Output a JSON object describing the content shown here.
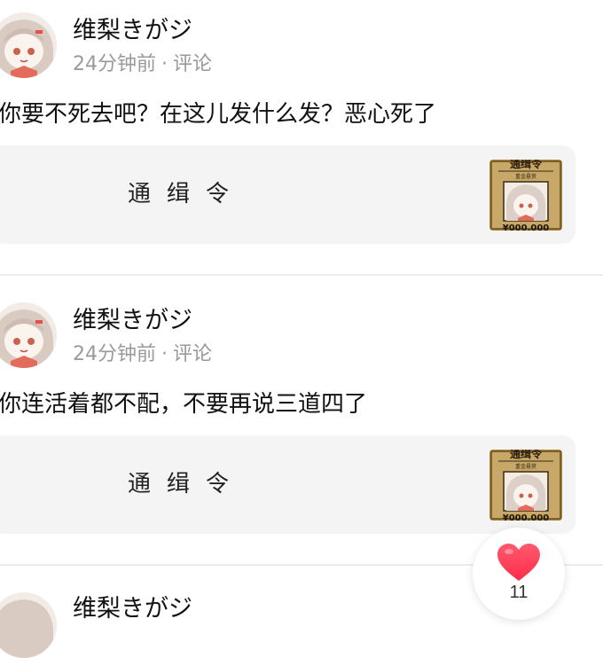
{
  "posts": [
    {
      "user_name": "维梨きがジ",
      "time": "24分钟前",
      "separator": "·",
      "action": "评论",
      "text": "你要不死去吧？在这儿发什么发？恶心死了",
      "card_title": "通缉令",
      "thumb": {
        "header": "通缉令",
        "sub": "重金悬赏",
        "bounty": "¥000,000"
      }
    },
    {
      "user_name": "维梨きがジ",
      "time": "24分钟前",
      "separator": "·",
      "action": "评论",
      "text": "你连活着都不配，不要再说三道四了",
      "card_title": "通缉令",
      "thumb": {
        "header": "通缉令",
        "sub": "重金悬赏",
        "bounty": "¥000,000"
      }
    }
  ],
  "partial_post": {
    "user_name": "维梨きがジ"
  },
  "like": {
    "count": "11",
    "icon": "heart-icon",
    "color": "#ff3b55"
  },
  "colors": {
    "card_bg": "#f4f4f4",
    "meta": "#9a9a9a",
    "divider": "#ececec"
  }
}
